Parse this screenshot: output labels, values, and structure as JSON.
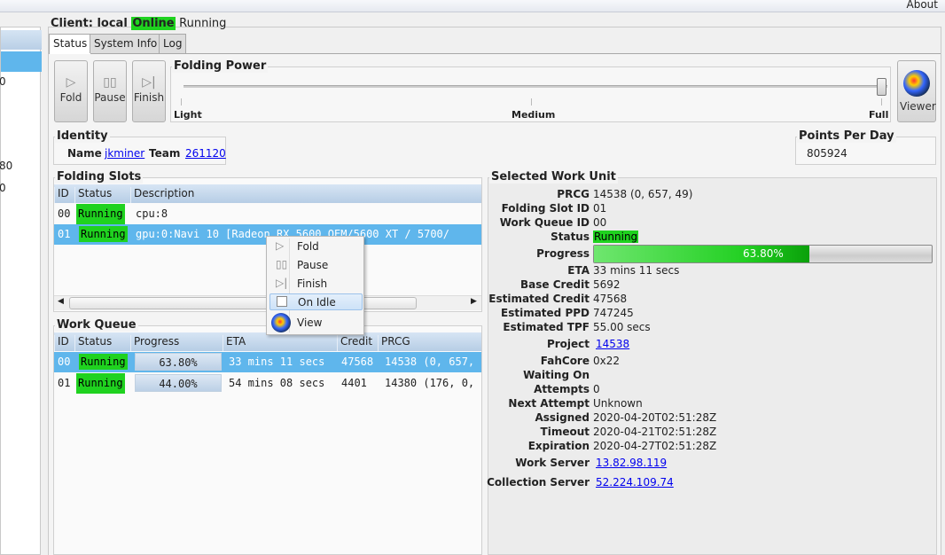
{
  "menubar": {
    "about": "About"
  },
  "sidebar": {
    "fragments": [
      "0",
      "80",
      "0"
    ]
  },
  "client": {
    "label": "Client: local",
    "online": "Online",
    "state": "Running"
  },
  "tabs": [
    "Status",
    "System Info",
    "Log"
  ],
  "controls": {
    "fold": "Fold",
    "pause": "Pause",
    "finish": "Finish",
    "viewer": "Viewer"
  },
  "folding_power": {
    "title": "Folding Power",
    "light": "Light",
    "medium": "Medium",
    "full": "Full",
    "level": 1.0
  },
  "identity": {
    "title": "Identity",
    "name_label": "Name",
    "name": "jkminer",
    "team_label": "Team",
    "team": "261120"
  },
  "ppd": {
    "title": "Points Per Day",
    "value": "805924"
  },
  "folding_slots": {
    "title": "Folding Slots",
    "columns": [
      "ID",
      "Status",
      "Description"
    ],
    "rows": [
      {
        "id": "00",
        "status": "Running",
        "description": "cpu:8"
      },
      {
        "id": "01",
        "status": "Running",
        "description": "gpu:0:Navi 10 [Radeon RX 5600 OEM/5600 XT / 5700/"
      }
    ]
  },
  "work_queue": {
    "title": "Work Queue",
    "columns": [
      "ID",
      "Status",
      "Progress",
      "ETA",
      "Credit",
      "PRCG"
    ],
    "rows": [
      {
        "id": "00",
        "status": "Running",
        "progress": "63.80%",
        "eta": "33 mins 11 secs",
        "credit": "47568",
        "prcg": "14538 (0, 657,"
      },
      {
        "id": "01",
        "status": "Running",
        "progress": "44.00%",
        "eta": "54 mins 08 secs",
        "credit": "4401",
        "prcg": "14380 (176, 0,"
      }
    ]
  },
  "context_menu": {
    "items": [
      "Fold",
      "Pause",
      "Finish",
      "On Idle",
      "View"
    ]
  },
  "selected_wu": {
    "title": "Selected Work Unit",
    "prcg_label": "PRCG",
    "prcg": "14538 (0, 657, 49)",
    "slot_label": "Folding Slot ID",
    "slot": "01",
    "wq_label": "Work Queue ID",
    "wq": "00",
    "status_label": "Status",
    "status": "Running",
    "progress_label": "Progress",
    "progress": "63.80%",
    "progress_value": 63.8,
    "eta_label": "ETA",
    "eta": "33 mins 11 secs",
    "base_label": "Base Credit",
    "base": "5692",
    "est_credit_label": "Estimated Credit",
    "est_credit": "47568",
    "est_ppd_label": "Estimated PPD",
    "est_ppd": "747245",
    "est_tpf_label": "Estimated TPF",
    "est_tpf": "55.00 secs",
    "project_label": "Project",
    "project": "14538",
    "core_label": "FahCore",
    "core": "0x22",
    "waiting_label": "Waiting On",
    "attempts_label": "Attempts",
    "attempts": "0",
    "next_label": "Next Attempt",
    "next": "Unknown",
    "assigned_label": "Assigned",
    "assigned": "2020-04-20T02:51:28Z",
    "timeout_label": "Timeout",
    "timeout": "2020-04-21T02:51:28Z",
    "expiration_label": "Expiration",
    "expiration": "2020-04-27T02:51:28Z",
    "ws_label": "Work Server",
    "ws": "13.82.98.119",
    "cs_label": "Collection Server",
    "cs": "52.224.109.74"
  },
  "colors": {
    "running": "#1fd21f",
    "selection": "#5fb6ec",
    "link": "#0000ee"
  }
}
